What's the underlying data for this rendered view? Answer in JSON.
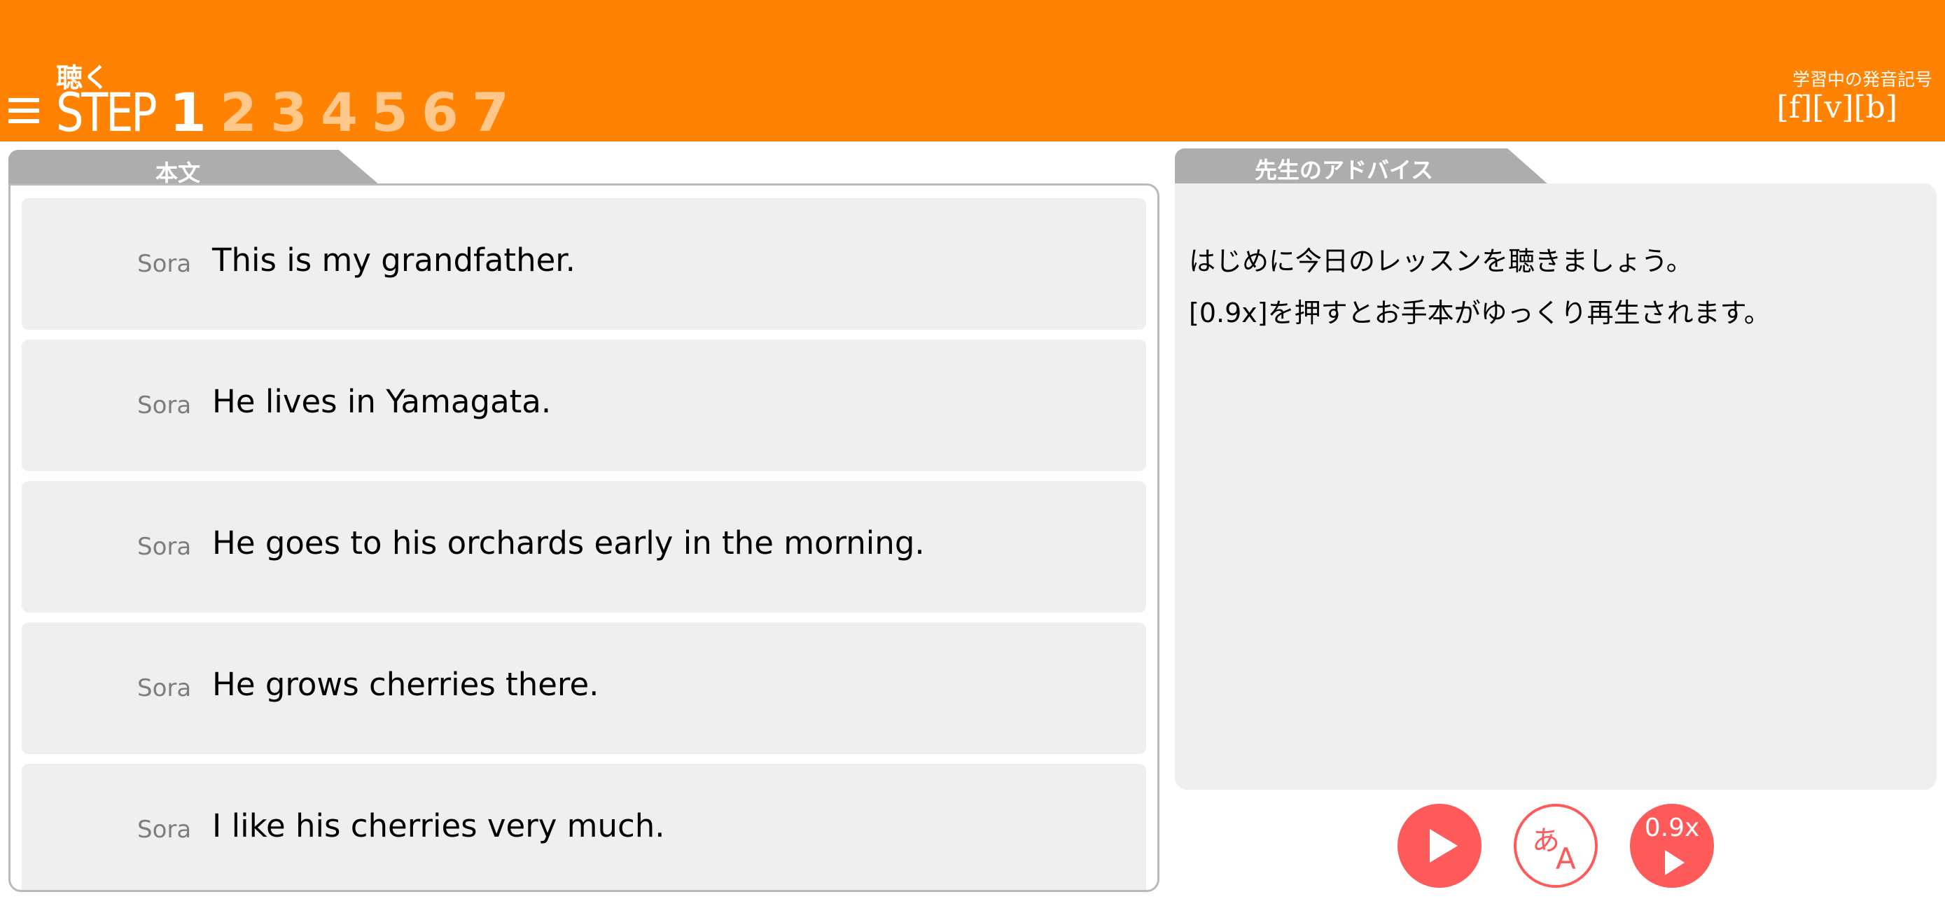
{
  "header": {
    "step_kicker": "聴く",
    "step_word": "STEP",
    "steps": [
      "1",
      "2",
      "3",
      "4",
      "5",
      "6",
      "7"
    ],
    "active_step": "1",
    "learning_label": "学習中の発音記号",
    "phonetics": [
      "[f]",
      "[v]",
      "[b]"
    ]
  },
  "text_panel": {
    "tab_label": "本文",
    "rows": [
      {
        "speaker": "Sora",
        "sentence": "This is my grandfather."
      },
      {
        "speaker": "Sora",
        "sentence": "He lives in Yamagata."
      },
      {
        "speaker": "Sora",
        "sentence": "He goes to his orchards early in the morning."
      },
      {
        "speaker": "Sora",
        "sentence": "He grows cherries there."
      },
      {
        "speaker": "Sora",
        "sentence": "I like his cherries very much."
      }
    ]
  },
  "advice_panel": {
    "tab_label": "先生のアドバイス",
    "lines": [
      "はじめに今日のレッスンを聴きましょう。",
      "[0.9x]を押すとお手本がゆっくり再生されます。"
    ]
  },
  "controls": {
    "translate_ja": "あ",
    "translate_en": "A",
    "slow_speed": "0.9x"
  },
  "colors": {
    "header_bg": "#ff8203",
    "accent_red": "#ff5a5a",
    "panel_bg": "#efefef",
    "tab_gray": "#adadad"
  }
}
